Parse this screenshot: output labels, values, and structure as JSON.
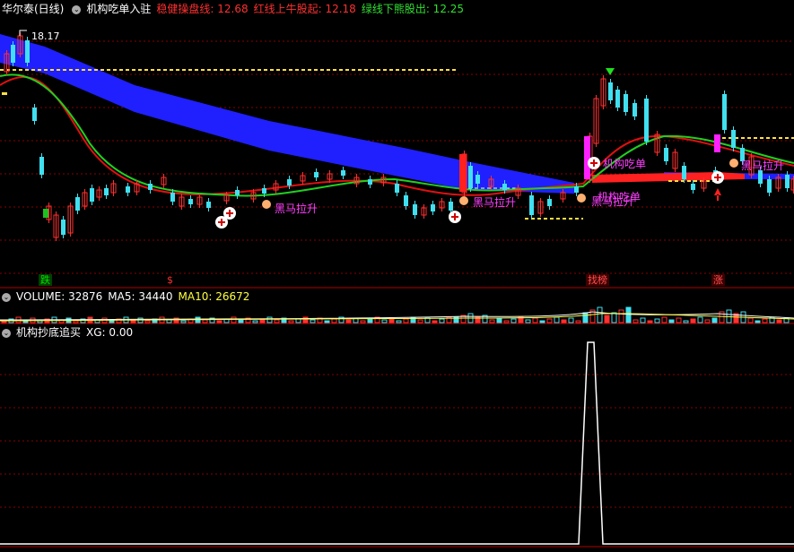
{
  "header": {
    "stock_name": "华尔泰(日线)",
    "indicator_name": "机构吃单入驻",
    "line1_label": "稳健操盘线: 12.68",
    "line2_label": "红线上牛股起: 12.18",
    "line3_label": "绿线下熊股出: 12.25"
  },
  "main": {
    "high_label": "18.17",
    "signals": [
      {
        "text": "黑马拉升"
      },
      {
        "text": "黑马拉升"
      },
      {
        "text": "黑马拉升"
      },
      {
        "text": "机构吃单"
      },
      {
        "text": "机构吃单"
      },
      {
        "text": "黑马拉升"
      }
    ],
    "bottom_tags": [
      {
        "text": "跌",
        "color": "#00c000"
      },
      {
        "text": "$",
        "color": "#ff3030"
      },
      {
        "text": "找榜",
        "color": "#ff3030"
      },
      {
        "text": "涨",
        "color": "#ff3030"
      }
    ]
  },
  "volume": {
    "label": "VOLUME: 32876",
    "ma5": "MA5: 34440",
    "ma10": "MA10: 26672"
  },
  "sub": {
    "name": "机构抄底追买",
    "value": "XG: 0.00"
  },
  "colors": {
    "up": "#ff3030",
    "down": "#40e0f0",
    "band": "#2020ff",
    "ma_red": "#e01010",
    "ma_green": "#20d020",
    "grid": "#8a0000"
  }
}
